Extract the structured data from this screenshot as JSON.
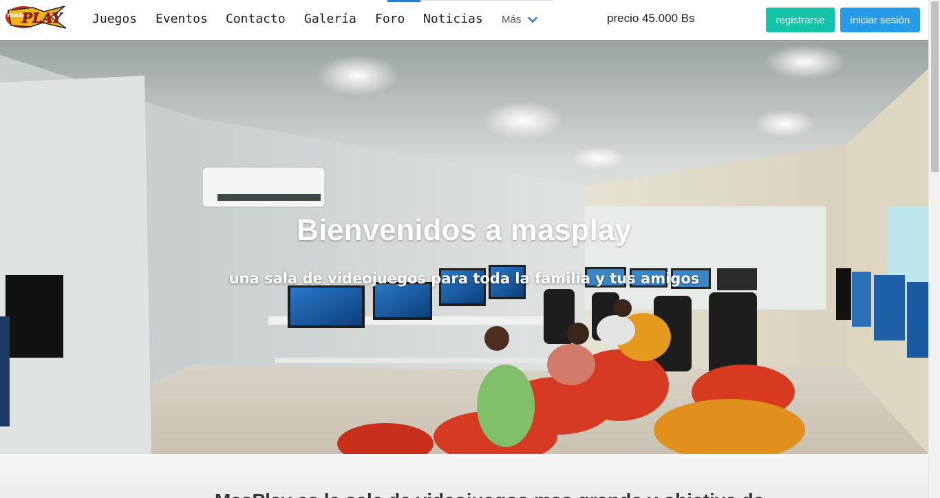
{
  "brand": {
    "logo_text": "masPLAY"
  },
  "nav": {
    "links": [
      {
        "label": "Juegos"
      },
      {
        "label": "Eventos"
      },
      {
        "label": "Contacto"
      },
      {
        "label": "Galería"
      },
      {
        "label": "Foro"
      },
      {
        "label": "Noticias"
      }
    ],
    "more_label": "Más"
  },
  "header": {
    "price_text": "precio 45.000 Bs",
    "register_label": "registrarse",
    "login_label": "iniciar sesión"
  },
  "hero": {
    "title": "Bienvenidos a masplay",
    "subtitle": "una sala de videojuegos para toda la familia y tus amigos"
  },
  "intro": {
    "heading_partial": "MasPlay es la sala de videojuegos mas grande y objetiva de..."
  },
  "colors": {
    "register": "#14c3a7",
    "login": "#279ae8",
    "active_nav": "#2b7bd0"
  },
  "icons": {
    "more": "chevron-down-icon"
  }
}
